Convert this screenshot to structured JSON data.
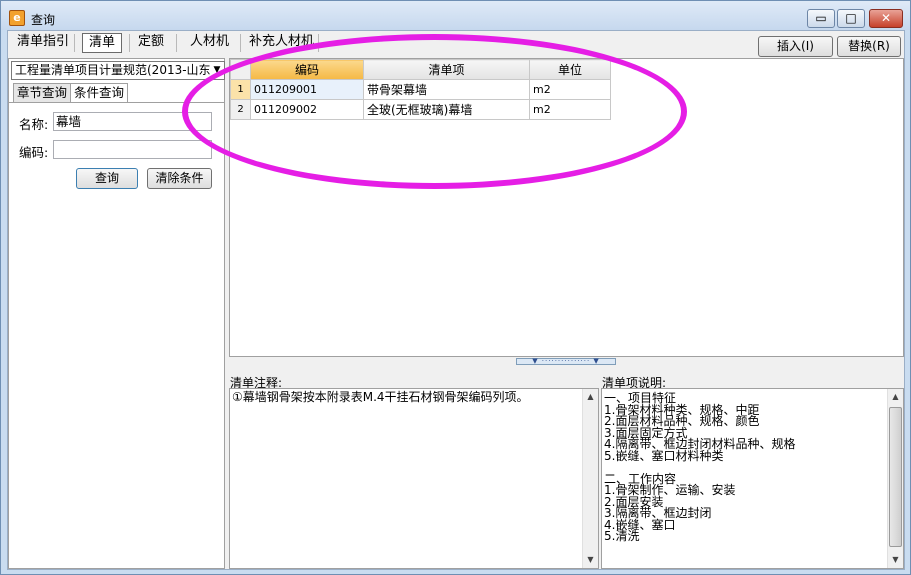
{
  "window": {
    "title": "查询",
    "icon_glyph": "e",
    "minimize_glyph": "▭",
    "maximize_glyph": "□",
    "close_glyph": "✕"
  },
  "tabs": [
    "清单指引",
    "清单",
    "定额",
    "人材机",
    "补充人材机"
  ],
  "actions": {
    "insert": "插入(I)",
    "replace": "替换(R)"
  },
  "left": {
    "spec_select": "工程量清单项目计量规范(2013-山东",
    "subtabs": [
      "章节查询",
      "条件查询"
    ],
    "name_label": "名称:",
    "name_value": "幕墙",
    "code_label": "编码:",
    "code_value": "",
    "query_button": "查询",
    "clear_button": "清除条件"
  },
  "grid": {
    "columns": [
      "编码",
      "清单项",
      "单位"
    ],
    "rows": [
      {
        "n": "1",
        "code": "011209001",
        "item": "带骨架幕墙",
        "unit": "m2"
      },
      {
        "n": "2",
        "code": "011209002",
        "item": "全玻(无框玻璃)幕墙",
        "unit": "m2"
      }
    ]
  },
  "splitter_glyph": "▼ ··············· ▼",
  "notes": {
    "title": "清单注释:",
    "text": "①幕墙钢骨架按本附录表M.4干挂石材钢骨架编码列项。"
  },
  "description": {
    "title": "清单项说明:",
    "lines": [
      "一、项目特征",
      "1.骨架材料种类、规格、中距",
      "2.面层材料品种、规格、颜色",
      "3.面层固定方式",
      "4.隔离带、框边封闭材料品种、规格",
      "5.嵌缝、塞口材料种类",
      "",
      "二、工作内容",
      "1.骨架制作、运输、安装",
      "2.面层安装",
      "3.隔离带、框边封闭",
      "4.嵌缝、塞口",
      "5.清洗"
    ]
  },
  "colors": {
    "annotation": "#e51ee5",
    "header_highlight": "#f5b844"
  }
}
